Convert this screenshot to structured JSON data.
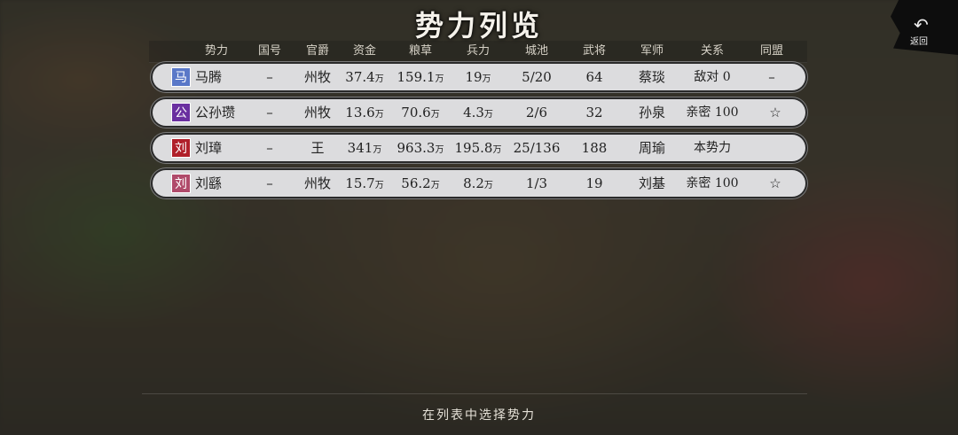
{
  "title": "势力列览",
  "back": {
    "label": "返回"
  },
  "columns": [
    "势力",
    "国号",
    "官爵",
    "资金",
    "粮草",
    "兵力",
    "城池",
    "武将",
    "军师",
    "关系",
    "同盟"
  ],
  "rows": [
    {
      "badge": "马",
      "badge_color": "#5a78c8",
      "name": "马腾",
      "country": "–",
      "rank": "州牧",
      "funds": "37.4",
      "food": "159.1",
      "troops": "19",
      "unit": "万",
      "cities": "5/20",
      "generals": "64",
      "advisor": "蔡琰",
      "relation": "敌对 0",
      "alliance": "–",
      "star": false
    },
    {
      "badge": "公",
      "badge_color": "#6a2fa0",
      "name": "公孙瓒",
      "country": "–",
      "rank": "州牧",
      "funds": "13.6",
      "food": "70.6",
      "troops": "4.3",
      "unit": "万",
      "cities": "2/6",
      "generals": "32",
      "advisor": "孙泉",
      "relation": "亲密 100",
      "alliance": "",
      "star": true
    },
    {
      "badge": "刘",
      "badge_color": "#b0202a",
      "name": "刘璋",
      "country": "–",
      "rank": "王",
      "funds": "341",
      "food": "963.3",
      "troops": "195.8",
      "unit": "万",
      "cities": "25/136",
      "generals": "188",
      "advisor": "周瑜",
      "relation": "本势力",
      "alliance": "",
      "star": false
    },
    {
      "badge": "刘",
      "badge_color": "#b04a6a",
      "name": "刘繇",
      "country": "–",
      "rank": "州牧",
      "funds": "15.7",
      "food": "56.2",
      "troops": "8.2",
      "unit": "万",
      "cities": "1/3",
      "generals": "19",
      "advisor": "刘基",
      "relation": "亲密 100",
      "alliance": "",
      "star": true
    }
  ],
  "footer": "在列表中选择势力",
  "icons": {
    "back": "undo-arrow-icon",
    "star": "star-outline-icon"
  }
}
